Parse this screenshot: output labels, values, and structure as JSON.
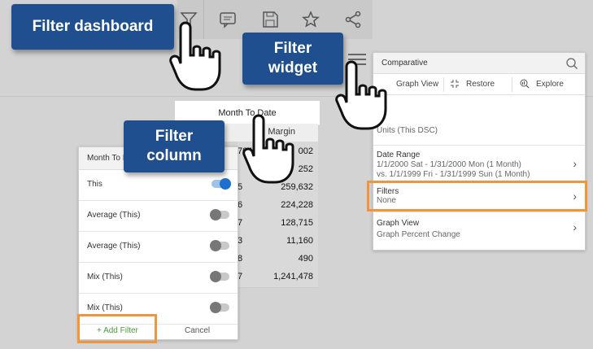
{
  "callouts": {
    "dashboard": "Filter dashboard",
    "widget_line1": "Filter",
    "widget_line2": "widget",
    "column_line1": "Filter",
    "column_line2": "column"
  },
  "toolbar": {
    "icons": [
      "filter-icon",
      "comment-icon",
      "save-icon",
      "star-icon",
      "share-icon"
    ]
  },
  "table": {
    "title": "Month To Date",
    "column": "Margin",
    "rows": [
      {
        "lead": "704",
        "value": "002"
      },
      {
        "lead": "",
        "value": "252"
      },
      {
        "lead": "5",
        "value": "259,632"
      },
      {
        "lead": "6",
        "value": "224,228"
      },
      {
        "lead": "7",
        "value": "128,715"
      },
      {
        "lead": "3",
        "value": "11,160"
      },
      {
        "lead": "8",
        "value": "490"
      },
      {
        "lead": "7",
        "value": "1,241,478"
      }
    ]
  },
  "column_panel": {
    "title": "Month To I",
    "items": [
      {
        "label": "This",
        "on": true
      },
      {
        "label": "Average (This)",
        "on": false
      },
      {
        "label": "Average (This)",
        "on": false
      },
      {
        "label": "Mix (This)",
        "on": false
      },
      {
        "label": "Mix (This)",
        "on": false
      }
    ],
    "add_filter": "+ Add Filter",
    "cancel": "Cancel"
  },
  "widget_panel": {
    "title": "Comparative",
    "tabs": [
      "Graph View",
      "Restore",
      "Explore"
    ],
    "units": "Units (This DSC)",
    "date_range_label": "Date Range",
    "date_range_line1": "1/1/2000 Sat - 1/31/2000 Mon (1 Month)",
    "date_range_line2": "vs. 1/1/1999 Fri - 1/31/1999 Sun (1 Month)",
    "filters_label": "Filters",
    "filters_value": "None",
    "graph_view_label": "Graph View",
    "graph_view_value": "Graph Percent Change"
  },
  "colors": {
    "callout_bg": "#1f4f8e",
    "highlight": "#f0953a",
    "toggle_on": "#1e6fd0",
    "add_filter": "#4a9a3a"
  }
}
